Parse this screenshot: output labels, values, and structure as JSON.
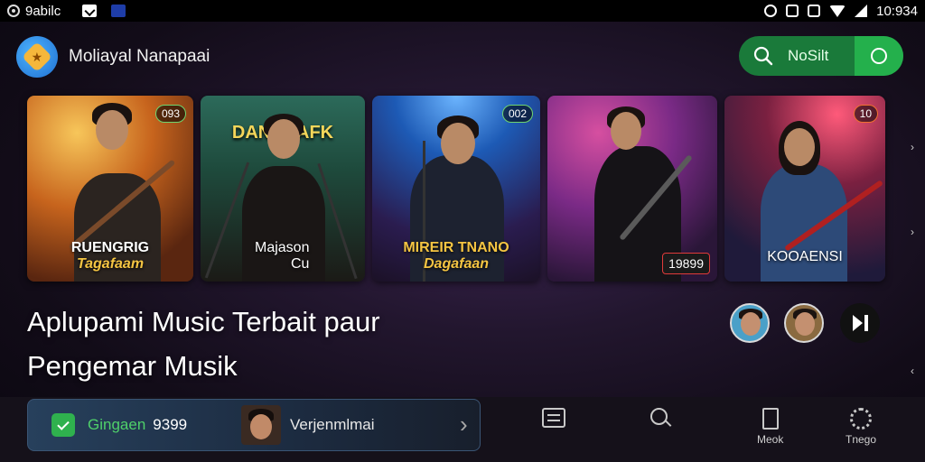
{
  "status_bar": {
    "left_text": "9abilc",
    "time": "10:934",
    "icons": [
      "record-icon",
      "check-icon",
      "app-icon",
      "alarm-icon",
      "nfc-icon",
      "lock-icon",
      "wifi-icon",
      "signal-icon"
    ]
  },
  "header": {
    "app_title": "Moliayal Nanapaai",
    "logo_icon": "star-badge-icon"
  },
  "search": {
    "label": "NoSilt",
    "accent": "#1a7a3a",
    "toggle_color": "#24b04c"
  },
  "cards": [
    {
      "badge": "093",
      "line1": "RUENGRIG",
      "line2": "Tagafaam"
    },
    {
      "badge": "",
      "line1": "Majason",
      "line2": "Cu",
      "banner": "DANI MAFK"
    },
    {
      "badge": "002",
      "line1": "MIREIR TNANO",
      "line2": "Dagafaan"
    },
    {
      "badge": "",
      "line1": "",
      "line2": "",
      "price": "19899"
    },
    {
      "badge": "10",
      "line1": "KOOAENSI",
      "line2": ""
    }
  ],
  "headline": {
    "line1": "Aplupami Music Terbait paur",
    "line2": "Pengemar Musik"
  },
  "now_playing": {
    "label": "Gingaen",
    "count": "9399",
    "title": "Verjenmlmai"
  },
  "nav": {
    "list_label": "",
    "search_label": "",
    "book_label": "Meok",
    "settings_label": "Tnego"
  }
}
